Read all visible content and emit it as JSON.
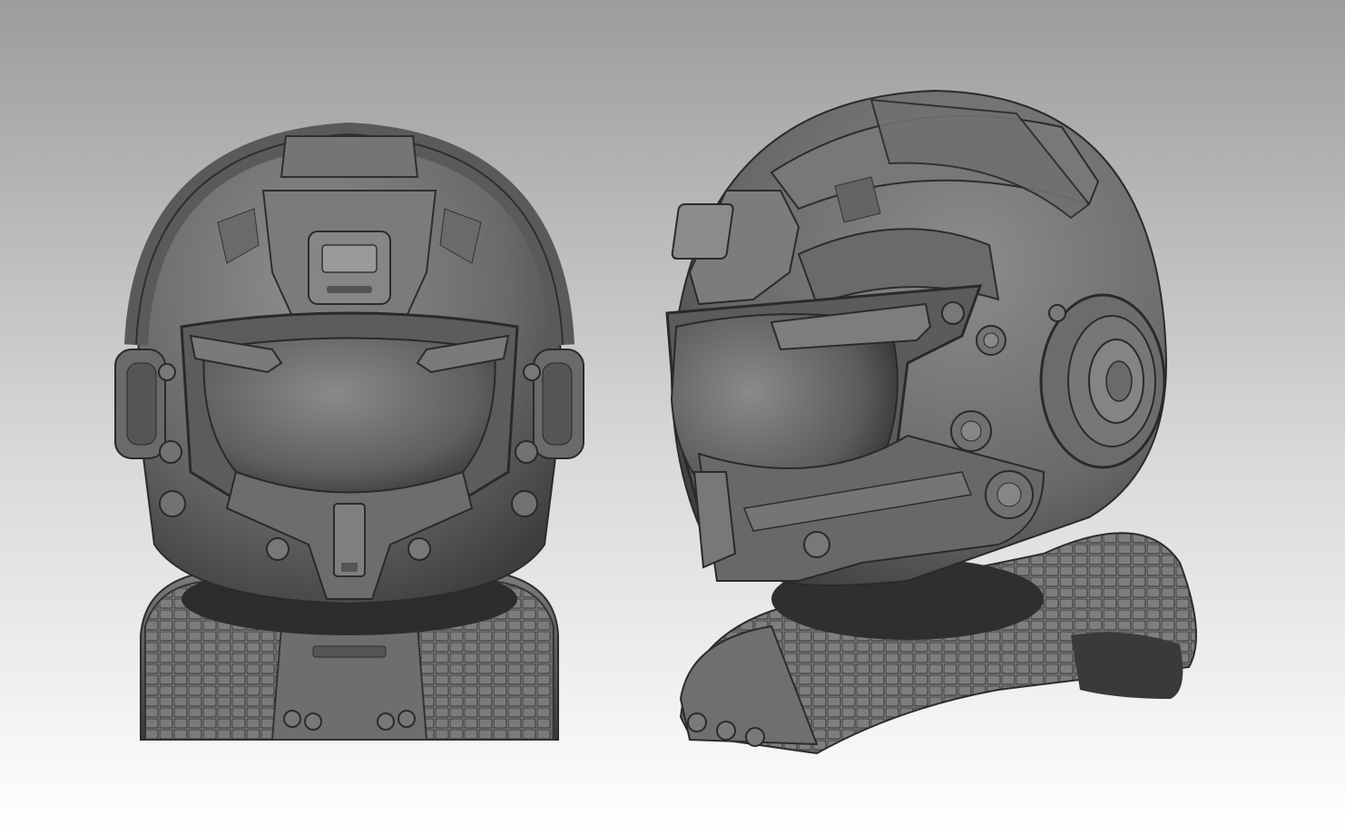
{
  "scene": {
    "subject": "sci-fi-helmet-sculpt",
    "views": [
      {
        "id": "front-view",
        "icon": "helmet-front-icon"
      },
      {
        "id": "three-quarter-view",
        "icon": "helmet-side-icon"
      }
    ],
    "colors": {
      "background_top": "#9c9c9c",
      "background_bottom": "#ffffff",
      "clay_light": "#8a8a8a",
      "clay_mid": "#6c6c6c",
      "clay_dark": "#454545",
      "clay_shadow": "#2a2a2a"
    }
  }
}
